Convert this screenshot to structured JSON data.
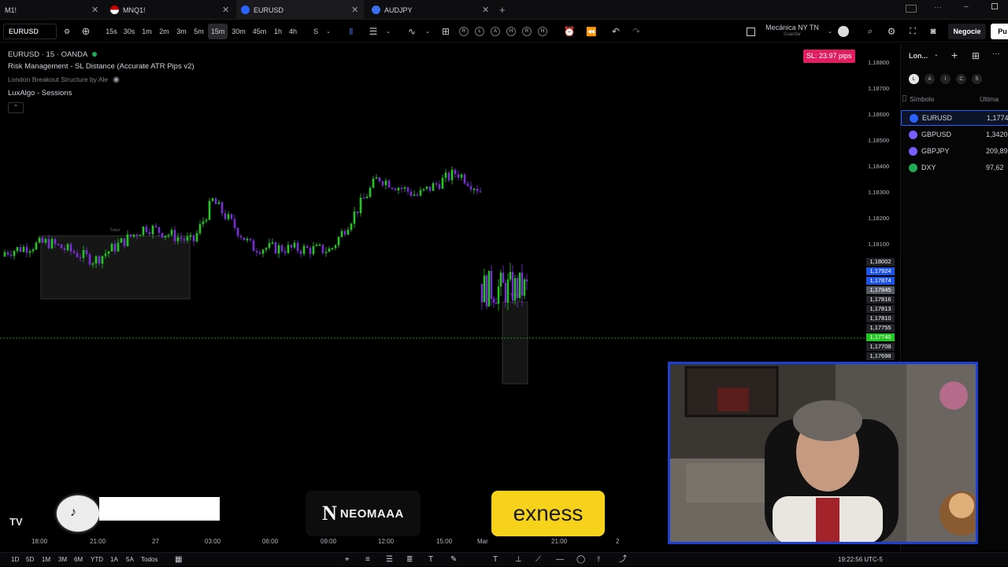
{
  "tabs": [
    {
      "label": "M1!"
    },
    {
      "label": "MNQ1!"
    },
    {
      "label": "EURUSD"
    },
    {
      "label": "AUDJPY"
    }
  ],
  "toolbar": {
    "symbol": "EURUSD",
    "intervals": [
      "15s",
      "30s",
      "1m",
      "2m",
      "3m",
      "5m",
      "15m",
      "30m",
      "45m",
      "1h",
      "4h",
      "S"
    ],
    "active_interval": "15m",
    "indicator_buttons": [
      "R",
      "L",
      "A",
      "H",
      "R",
      "H"
    ],
    "layout_name": "Mecánica NY TN",
    "layout_sub": "Guardar",
    "trade_button": "Negocie",
    "publish_button": "Pu"
  },
  "legend": {
    "title": "EURUSD · 15 · OANDA",
    "ind1": "Risk Management - SL Distance (Accurate ATR Pips v2)",
    "ind2": "London Breakout Structure by Ale",
    "ind3": "LuxAlgo - Sessions"
  },
  "sl_badge": "SL: 23.97 pips",
  "price_axis": [
    "1,18800",
    "1,18700",
    "1,18600",
    "1,18500",
    "1,18400",
    "1,18300",
    "1,18200",
    "1,18100"
  ],
  "price_labels": [
    {
      "text": "1,18002",
      "color": "#202226"
    },
    {
      "text": "1,17924",
      "color": "#1e53e5"
    },
    {
      "text": "1,17874",
      "color": "#1e53e5"
    },
    {
      "text": "1,17845",
      "color": "#555a63"
    },
    {
      "text": "1,17816",
      "color": "#202226"
    },
    {
      "text": "1,17813",
      "color": "#202226"
    },
    {
      "text": "1,17810",
      "color": "#202226"
    },
    {
      "text": "1,17755",
      "color": "#202226"
    },
    {
      "text": "1,17740",
      "color": "#22c722"
    },
    {
      "text": "1,17708",
      "color": "#202226"
    },
    {
      "text": "1,17698",
      "color": "#202226"
    }
  ],
  "session_labels": [
    "Tokyo",
    "Tokyo"
  ],
  "time_axis": [
    "18:00",
    "21:00",
    "27",
    "03:00",
    "06:00",
    "09:00",
    "12:00",
    "15:00",
    "Mar",
    "21:00",
    "2"
  ],
  "watchlist": {
    "name": "Lon...",
    "filters": [
      "L",
      "A",
      "I",
      "C",
      "S"
    ],
    "col_symbol": "Símbolo",
    "col_last": "Última",
    "rows": [
      {
        "symbol": "EURUSD",
        "price": "1,1774",
        "color": "#2962ff"
      },
      {
        "symbol": "GBPUSD",
        "price": "1,3420",
        "color": "#7b5cff"
      },
      {
        "symbol": "GBPJPY",
        "price": "209,89",
        "color": "#7b5cff"
      },
      {
        "symbol": "DXY",
        "price": "97,62",
        "color": "#22ab55"
      }
    ]
  },
  "ranges": [
    "1D",
    "5D",
    "1M",
    "3M",
    "6M",
    "YTD",
    "1A",
    "5A",
    "Todos"
  ],
  "clock": "19:22:56 UTC-5",
  "sponsors": {
    "neomaaa": "NEOMAAA",
    "exness": "exness"
  },
  "tradingview_logo": "TV",
  "colors": {
    "up": "#22c722",
    "down": "#7a2fd6",
    "accent": "#2962ff",
    "badge": "#e01d60"
  }
}
